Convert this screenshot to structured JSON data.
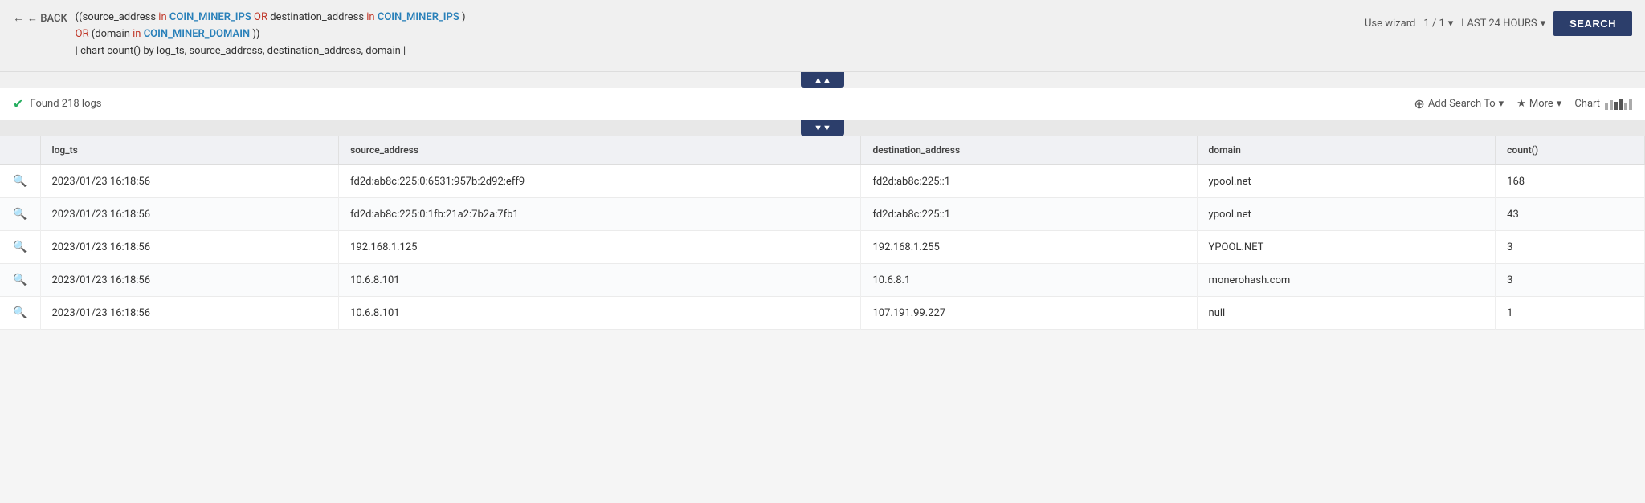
{
  "back_button": "← BACK",
  "query": {
    "line1": "((source_address in COIN_MINER_IPS OR destination_address in COIN_MINER_IPS)",
    "line2": "OR (domain in COIN_MINER_DOMAIN))",
    "line3": "| chart count() by log_ts, source_address, destination_address, domain |",
    "keywords_red": [
      "OR",
      "in"
    ],
    "keywords_blue": [
      "COIN_MINER_IPS",
      "COIN_MINER_DOMAIN"
    ]
  },
  "toolbar": {
    "use_wizard": "Use wizard",
    "pagination": "1 / 1",
    "time_range": "LAST 24 HOURS",
    "search_btn": "SEARCH"
  },
  "results": {
    "found_text": "Found 218 logs",
    "add_search_label": "Add Search To",
    "more_label": "More",
    "chart_label": "Chart"
  },
  "table": {
    "headers": [
      "",
      "log_ts",
      "source_address",
      "destination_address",
      "domain",
      "count()"
    ],
    "rows": [
      {
        "icon": "🔍",
        "log_ts": "2023/01/23 16:18:56",
        "source_address": "fd2d:ab8c:225:0:6531:957b:2d92:eff9",
        "destination_address": "fd2d:ab8c:225::1",
        "domain": "ypool.net",
        "count": "168"
      },
      {
        "icon": "🔍",
        "log_ts": "2023/01/23 16:18:56",
        "source_address": "fd2d:ab8c:225:0:1fb:21a2:7b2a:7fb1",
        "destination_address": "fd2d:ab8c:225::1",
        "domain": "ypool.net",
        "count": "43"
      },
      {
        "icon": "🔍",
        "log_ts": "2023/01/23 16:18:56",
        "source_address": "192.168.1.125",
        "destination_address": "192.168.1.255",
        "domain": "YPOOL.NET",
        "count": "3"
      },
      {
        "icon": "🔍",
        "log_ts": "2023/01/23 16:18:56",
        "source_address": "10.6.8.101",
        "destination_address": "10.6.8.1",
        "domain": "monerohash.com",
        "count": "3"
      },
      {
        "icon": "🔍",
        "log_ts": "2023/01/23 16:18:56",
        "source_address": "10.6.8.101",
        "destination_address": "107.191.99.227",
        "domain": "null",
        "count": "1"
      }
    ]
  }
}
